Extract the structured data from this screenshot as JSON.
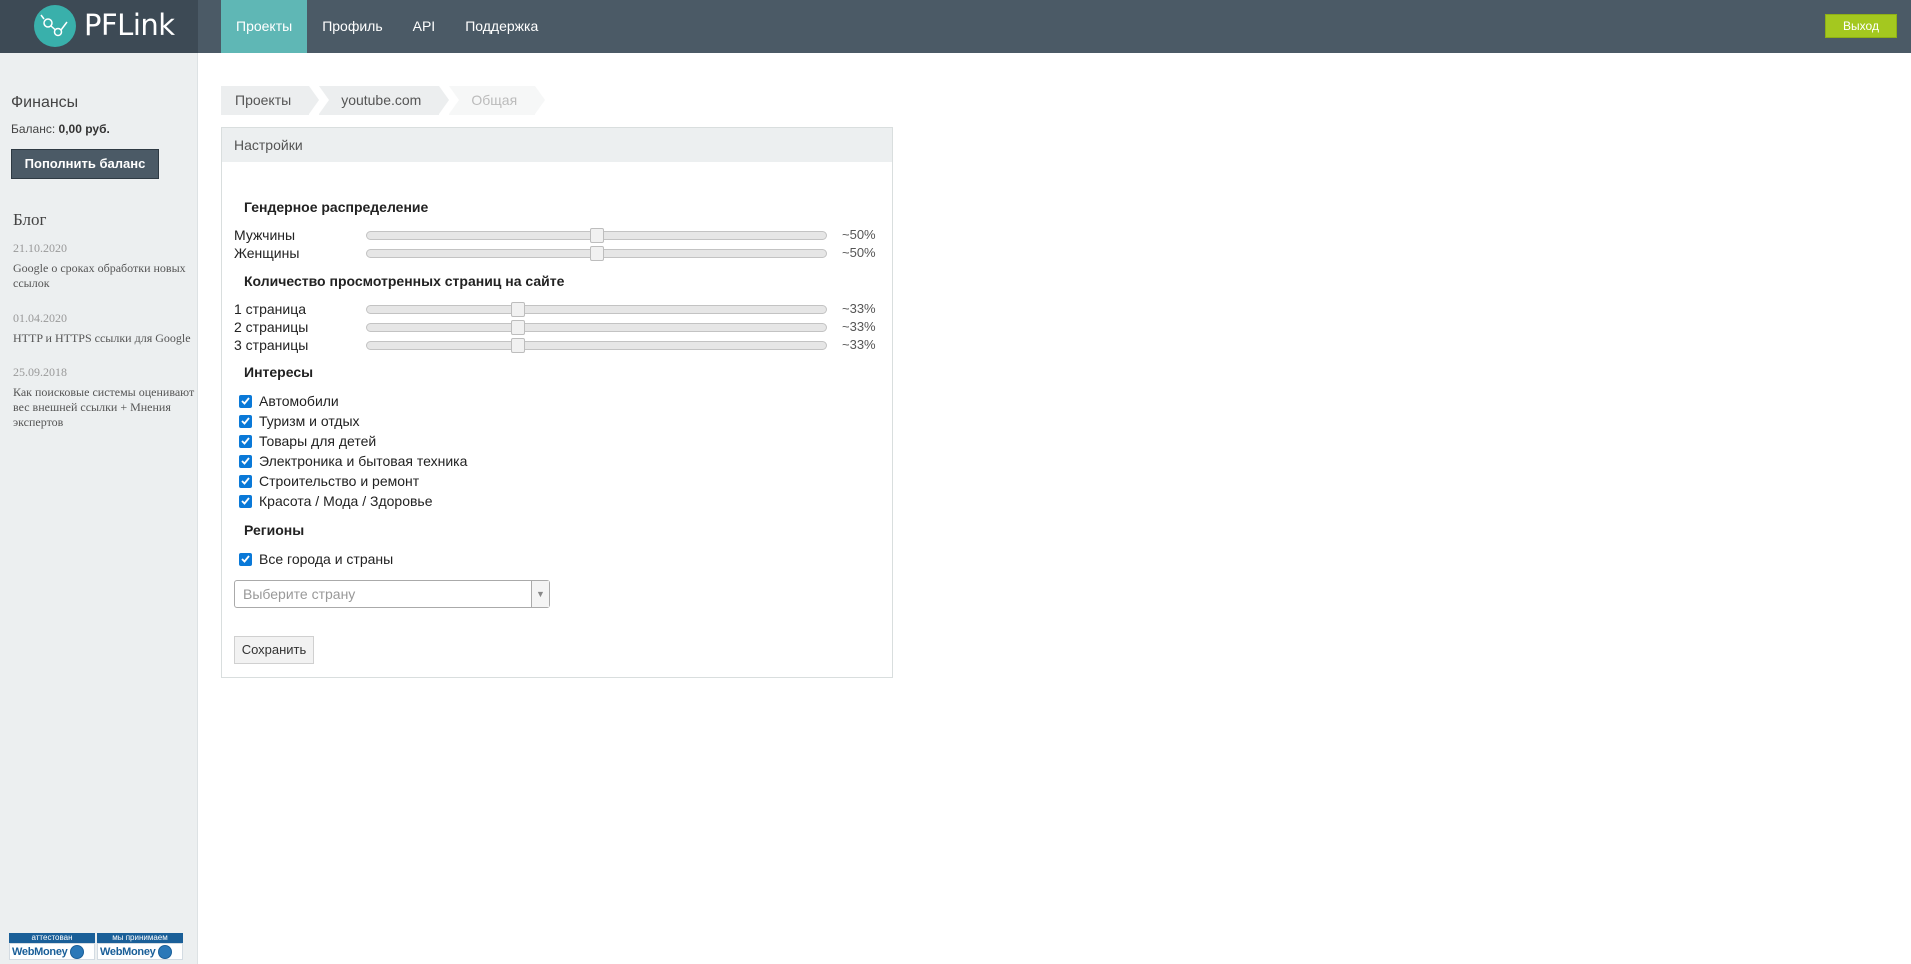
{
  "header": {
    "logo_text": "PFLink",
    "nav": [
      {
        "label": "Проекты",
        "active": true
      },
      {
        "label": "Профиль",
        "active": false
      },
      {
        "label": "API",
        "active": false
      },
      {
        "label": "Поддержка",
        "active": false
      }
    ],
    "logout_label": "Выход",
    "colors": {
      "topbar": "#4b5a66",
      "active_tab": "#5fb7b5",
      "logout": "#a4c81f",
      "logo": "#39b0ab"
    }
  },
  "sidebar": {
    "finance_title": "Финансы",
    "balance_label": "Баланс:",
    "balance_value": "0,00 руб.",
    "topup_label": "Пополнить баланс",
    "blog_title": "Блог",
    "posts": [
      {
        "date": "21.10.2020",
        "title": "Google о сроках обработки новых ссылок"
      },
      {
        "date": "01.04.2020",
        "title": "HTTP и HTTPS ссылки для Google"
      },
      {
        "date": "25.09.2018",
        "title": "Как поисковые системы оценивают вес внешней ссылки + Мнения экспертов"
      }
    ],
    "badges": [
      {
        "top": "аттестован",
        "bottom": "WebMoney",
        "icon": "webmoney-globe-icon"
      },
      {
        "top": "мы принимаем",
        "bottom": "WebMoney",
        "icon": "webmoney-globe-icon"
      }
    ]
  },
  "breadcrumb": [
    "Проекты",
    "youtube.com",
    "Общая"
  ],
  "settings": {
    "panel_title": "Настройки",
    "gender": {
      "title": "Гендерное распределение",
      "rows": [
        {
          "label": "Мужчины",
          "value": "~50%",
          "fraction": 0.5
        },
        {
          "label": "Женщины",
          "value": "~50%",
          "fraction": 0.5
        }
      ]
    },
    "pages": {
      "title": "Количество просмотренных страниц на сайте",
      "rows": [
        {
          "label": "1 страница",
          "value": "~33%",
          "fraction": 0.33
        },
        {
          "label": "2 страницы",
          "value": "~33%",
          "fraction": 0.33
        },
        {
          "label": "3 страницы",
          "value": "~33%",
          "fraction": 0.33
        }
      ]
    },
    "interests": {
      "title": "Интересы",
      "items": [
        {
          "label": "Автомобили",
          "checked": true
        },
        {
          "label": "Туризм и отдых",
          "checked": true
        },
        {
          "label": "Товары для детей",
          "checked": true
        },
        {
          "label": "Электроника и бытовая техника",
          "checked": true
        },
        {
          "label": "Строительство и ремонт",
          "checked": true
        },
        {
          "label": "Красота / Мода / Здоровье",
          "checked": true
        }
      ]
    },
    "regions": {
      "title": "Регионы",
      "all_label": "Все города и страны",
      "all_checked": true,
      "country_placeholder": "Выберите страну"
    },
    "save_label": "Сохранить"
  }
}
